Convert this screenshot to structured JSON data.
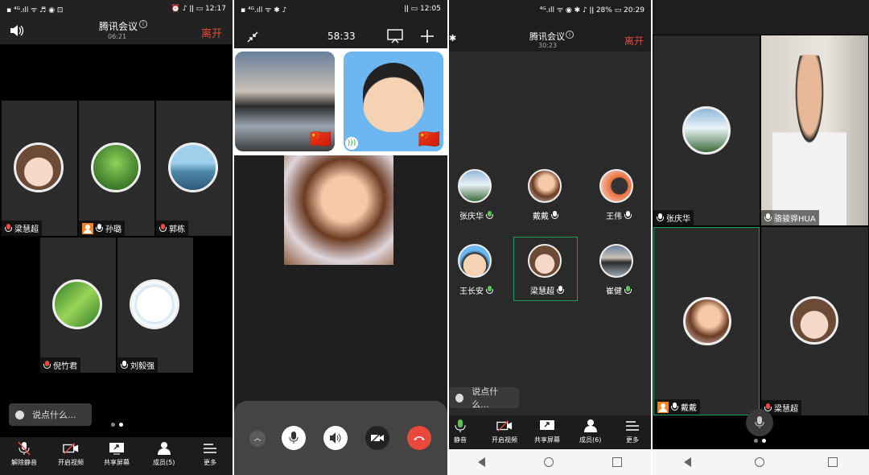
{
  "p1": {
    "status": {
      "left": "▪ ⁴ᴳ.ıll ᯤ ♬ ◉ ⊡",
      "right": "⏰ ♪ ǀǀ ▭ 12:17"
    },
    "title": "腾讯会议",
    "timer": "06:21",
    "leave": "离开",
    "participants": [
      {
        "name": "梁慧超",
        "mic": "off"
      },
      {
        "name": "孙璐",
        "mic": "on",
        "host": true
      },
      {
        "name": "郭栋",
        "mic": "off"
      },
      {
        "name": "倪竹君",
        "mic": "off"
      },
      {
        "name": "刘毅强",
        "mic": "on"
      }
    ],
    "chat_placeholder": "说点什么...",
    "toolbar": [
      "解除静音",
      "开启视频",
      "共享屏幕",
      "成员(5)",
      "更多"
    ]
  },
  "p2": {
    "status": {
      "left": "▪ ⁴ᴳ.ıll ᯤ ✱ ♪",
      "right": "ǀǀ ▭ 12:05"
    },
    "timer": "58:33",
    "flag": "🇨🇳"
  },
  "p3": {
    "status": {
      "right": "⁴ᴳ.ıll ᯤ ◉ ✱ ♪ ǀǀ 28% ▭ 20:29"
    },
    "title": "腾讯会议",
    "timer": "30:23",
    "leave": "离开",
    "participants": [
      "张庆华",
      "戴戴",
      "王伟",
      "王长安",
      "梁慧超",
      "崔健"
    ],
    "chat_placeholder": "说点什么...",
    "toolbar": [
      "静音",
      "开启视频",
      "共享屏幕",
      "成员(6)",
      "更多"
    ]
  },
  "p4": {
    "tiles": [
      "张庆华",
      "骆骏骅HUA",
      "戴戴",
      "梁慧超"
    ]
  },
  "colors": {
    "leave": "#e8473c",
    "active_border": "#1fa05a",
    "end_call": "#e8473c"
  }
}
